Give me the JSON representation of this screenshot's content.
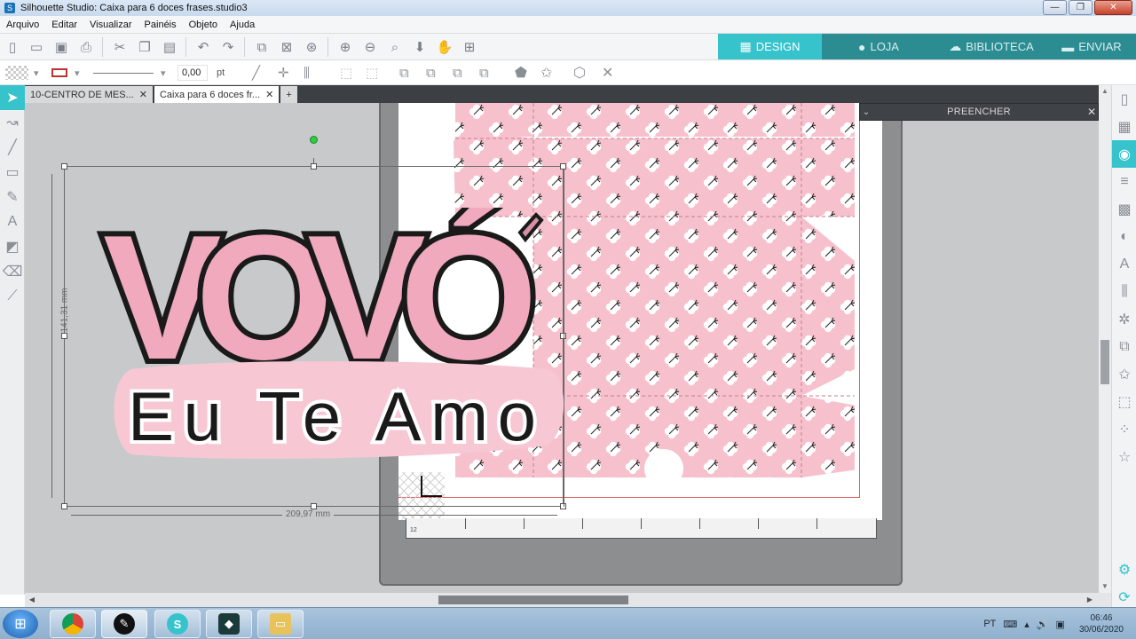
{
  "window": {
    "title": "Silhouette Studio: Caixa para 6 doces frases.studio3",
    "app_icon": "S",
    "minimize": "—",
    "maximize": "❐",
    "close": "✕"
  },
  "menu": {
    "items": [
      "Arquivo",
      "Editar",
      "Visualizar",
      "Painéis",
      "Objeto",
      "Ajuda"
    ]
  },
  "modes": {
    "design": "DESIGN",
    "store": "LOJA",
    "library": "BIBLIOTECA",
    "send": "ENVIAR"
  },
  "line_style": {
    "width_value": "0,00",
    "width_unit": "pt"
  },
  "documents": {
    "tabs": [
      {
        "label": "10-CENTRO DE MES...",
        "close": "✕",
        "active": false
      },
      {
        "label": "Caixa para 6 doces fr...",
        "close": "✕",
        "active": true
      }
    ],
    "add": "+"
  },
  "fill_panel": {
    "title": "PREENCHER",
    "collapse": "⌄",
    "close": "✕"
  },
  "selection": {
    "height_label": "141,31 mm",
    "width_label": "209,97 mm"
  },
  "artwork": {
    "headline": "VOVÓ",
    "tagline": "Eu Te Amo"
  },
  "mat": {
    "ruler_number": "12"
  },
  "taskbar": {
    "start": "⊞",
    "language": "PT",
    "time": "06:46",
    "date": "30/06/2020"
  },
  "colors": {
    "accent": "#36c3cc",
    "mode_tab": "#2b8c92",
    "pink": "#f4bccb",
    "pink_dark": "#d68fa4",
    "outline": "#1a1a1a"
  }
}
